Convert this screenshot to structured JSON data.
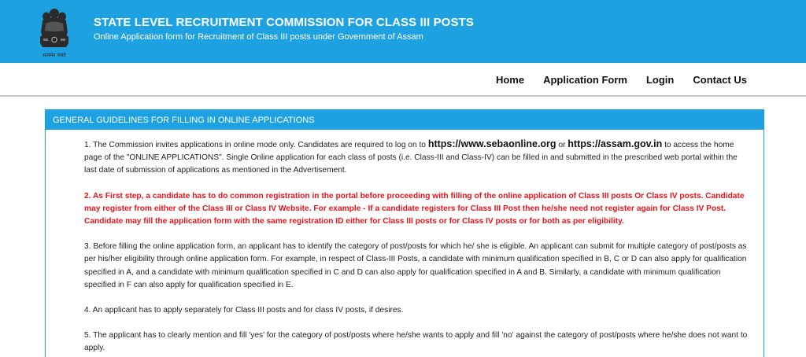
{
  "header": {
    "title": "STATE LEVEL RECRUITMENT COMMISSION FOR CLASS III POSTS",
    "subtitle": "Online Application form for Recruitment of Class III posts under Government of Assam"
  },
  "nav": {
    "items": [
      {
        "label": "Home"
      },
      {
        "label": "Application Form"
      },
      {
        "label": "Login"
      },
      {
        "label": "Contact Us"
      }
    ]
  },
  "guidelines": {
    "heading": "GENERAL GUIDELINES FOR FILLING IN ONLINE APPLICATIONS",
    "p1": {
      "a": "1. The Commission invites applications in online mode only. Candidates are required to log on to ",
      "link1": "https://www.sebaonline.org",
      "b": " or ",
      "link2": "https://assam.gov.in",
      "c": " to access the home page of the \"ONLINE APPLICATIONS\". Single Online application for each class of posts (i.e. Class-III and Class-IV) can be filled in and submitted in the prescribed web portal within the last date of submission of applications as mentioned in the Advertisement."
    },
    "p2": "2. As First step, a candidate has to do common registration in the portal before proceeding with filling of the online application of Class III posts Or Class IV posts. Candidate may register from either of the Class III or Class IV Website. For example - If a candidate registers for Class III Post then he/she need not register again for Class IV Post. Candidate may fill the application form with the same registration ID either for Class III posts or for Class IV posts or for both as per eligibility.",
    "p3": "3. Before filling the online application form, an applicant has to identify the category of post/posts for which he/ she is eligible. An applicant can submit for multiple category of post/posts as per his/her eligibility through online application form. For example, in respect of Class-III Posts, a candidate with minimum qualification specified in B, C or D can also apply for qualification specified in A, and a candidate with minimum qualification specified in C and D can also apply for qualification specified in A and B. Similarly, a candidate with minimum qualification specified in F can also apply for qualification specified in E.",
    "p4": "4. An applicant has to apply separately for Class III posts and for class IV posts, if desires.",
    "p5": "5. The applicant has to clearly mention and fill 'yes' for the category of post/posts where he/she wants to apply and fill 'no' against the category of post/posts where he/she does not want to apply."
  },
  "colors": {
    "header_blue": "#1ea1e0",
    "alert_red": "#e8141c"
  },
  "icons": {
    "emblem": "national-emblem-icon"
  }
}
